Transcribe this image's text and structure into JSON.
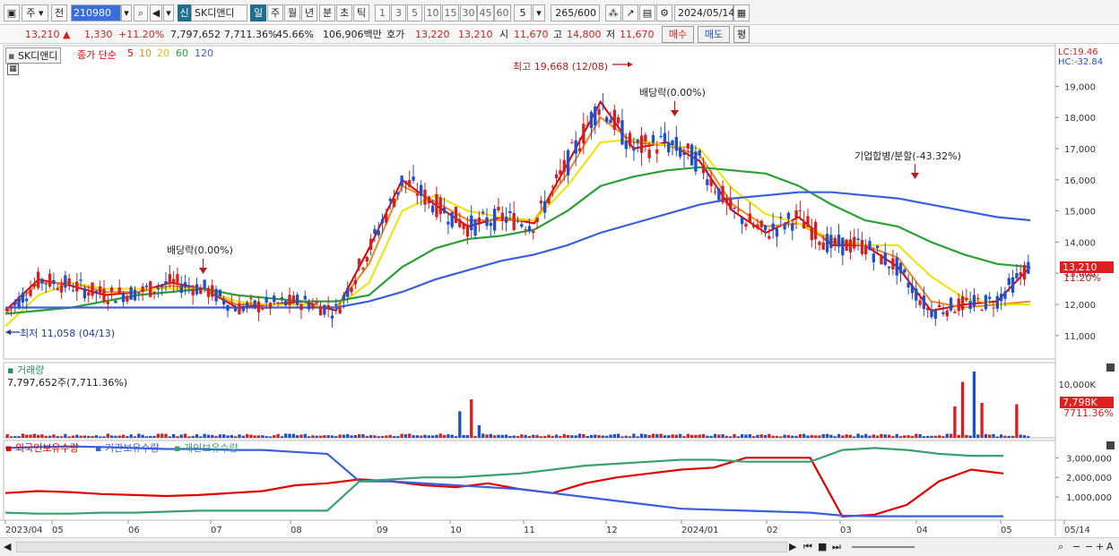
{
  "toolbar": {
    "period_ju": "주",
    "prev_label": "전",
    "code": "210980",
    "new_badge": "신",
    "name": "SK디앤디",
    "period_tabs": [
      "일",
      "주",
      "월",
      "년",
      "분",
      "초",
      "틱"
    ],
    "interval_buttons": [
      "1",
      "3",
      "5",
      "10",
      "15",
      "30",
      "45",
      "60"
    ],
    "interval_value": "5",
    "count": "265",
    "count_total": "/600",
    "date": "2024/05/14"
  },
  "infobar": {
    "price": "13,210",
    "change": "1,330",
    "change_pct": "+11.20%",
    "volume": "7,797,652",
    "volume_pct": "7,711.36%",
    "turnover": "45.66%",
    "amount": "106,906백만",
    "quote_label": "호가",
    "ask": "13,220",
    "bid": "13,210",
    "open_label": "시",
    "open": "11,670",
    "high_label": "고",
    "high": "14,800",
    "low_label": "저",
    "low": "11,670",
    "buy_label": "매수",
    "sell_label": "매도",
    "eval_label": "평"
  },
  "legend": {
    "name": "SK디앤디",
    "indicator": "종가 단순",
    "ma": [
      "5",
      "10",
      "20",
      "60",
      "120"
    ]
  },
  "colors": {
    "ma5": "#e00000",
    "ma10": "#f08a1c",
    "ma20": "#f2e200",
    "ma60": "#2aa035",
    "ma120": "#3a5fe0",
    "up": "#d42020",
    "down": "#1f4fcf",
    "foreign": "#e00000",
    "institution": "#3a5fe0",
    "individual": "#3aa070"
  },
  "annotations": {
    "high": "최고 19,668 (12/08)",
    "low": "최저 11,058 (04/13)",
    "div1": "배당락(0.00%)",
    "div2": "배당락(0.00%)",
    "merge": "기업합병/분할(-43.32%)"
  },
  "right_info": {
    "lc": "LC:19.46",
    "hc": "HC:-32.84",
    "price_tag": "13,210",
    "pct_tag": "11.20%",
    "vol_tag": "7,798K",
    "vol_pct_tag": "7711.36%"
  },
  "volume_panel": {
    "title": "거래량",
    "value": "7,797,652주(7,711.36%)"
  },
  "holdings_panel": {
    "labels": [
      "외국인보유수량",
      "기관보유수량",
      "개인보유수량"
    ]
  },
  "chart_data": [
    {
      "type": "line",
      "title": "SK디앤디",
      "x_ticks": [
        "2023/04",
        "05",
        "06",
        "07",
        "08",
        "09",
        "10",
        "11",
        "12",
        "2024/01",
        "02",
        "03",
        "04",
        "05",
        "05/14"
      ],
      "yticks": [
        11000,
        12000,
        13000,
        14000,
        15000,
        16000,
        17000,
        18000,
        19000
      ],
      "ylim": [
        10250,
        20300
      ],
      "series": [
        {
          "name": "5",
          "values": [
            11800,
            12800,
            12600,
            12300,
            12400,
            12700,
            12500,
            11900,
            12000,
            12100,
            11800,
            13800,
            16000,
            15200,
            14500,
            14800,
            14600,
            16500,
            18500,
            17000,
            17200,
            16600,
            15000,
            14300,
            14800,
            13900,
            13900,
            13200,
            11800,
            12000,
            12100,
            13200
          ]
        },
        {
          "name": "10",
          "values": [
            11700,
            12700,
            12700,
            12400,
            12400,
            12600,
            12500,
            12000,
            12000,
            12000,
            11900,
            13300,
            15800,
            15300,
            14700,
            14700,
            14700,
            16200,
            18000,
            17200,
            17100,
            16800,
            15200,
            14500,
            14600,
            14000,
            13900,
            13500,
            12100,
            11900,
            12000,
            12100
          ]
        },
        {
          "name": "20",
          "values": [
            11300,
            12300,
            12700,
            12500,
            12500,
            12500,
            12500,
            12100,
            12000,
            12000,
            11900,
            12700,
            15000,
            15500,
            15000,
            14800,
            14700,
            15800,
            17200,
            17300,
            17100,
            17000,
            15700,
            14900,
            14600,
            14100,
            13900,
            13900,
            12900,
            12200,
            12000,
            12000
          ]
        },
        {
          "name": "60",
          "values": [
            11700,
            11800,
            11900,
            12100,
            12300,
            12400,
            12500,
            12300,
            12200,
            12100,
            12100,
            12300,
            13200,
            13800,
            14100,
            14200,
            14400,
            15000,
            15800,
            16100,
            16300,
            16400,
            16300,
            16200,
            15800,
            15200,
            14700,
            14500,
            14000,
            13600,
            13300,
            13200
          ]
        },
        {
          "name": "120",
          "values": [
            11900,
            11900,
            11900,
            11900,
            11900,
            11900,
            11900,
            11900,
            11900,
            11900,
            11900,
            12100,
            12400,
            12800,
            13100,
            13400,
            13600,
            13900,
            14300,
            14600,
            14900,
            15200,
            15400,
            15500,
            15600,
            15600,
            15500,
            15400,
            15200,
            15000,
            14800,
            14700
          ]
        }
      ]
    },
    {
      "type": "bar",
      "title": "거래량",
      "yticks": [
        10000
      ],
      "ylabel": "K"
    },
    {
      "type": "line",
      "title": "외국인보유수량 / 기관보유수량 / 개인보유수량",
      "yticks": [
        1000000,
        2000000,
        3000000
      ],
      "ytick_labels": [
        "1,000,000",
        "2,000,000",
        "3,000,000"
      ],
      "series": [
        {
          "name": "외국인보유수량",
          "values": [
            1200000,
            1300000,
            1250000,
            1150000,
            1100000,
            1050000,
            1100000,
            1200000,
            1300000,
            1600000,
            1700000,
            1900000,
            1800000,
            1600000,
            1500000,
            1700000,
            1400000,
            1200000,
            1700000,
            2000000,
            2200000,
            2400000,
            2500000,
            3000000,
            3000000,
            3000000,
            0,
            100000,
            600000,
            1800000,
            2400000,
            2200000
          ]
        },
        {
          "name": "기관보유수량",
          "values": [
            3500000,
            3550000,
            3580000,
            3550000,
            3500000,
            3450000,
            3450000,
            3400000,
            3400000,
            3300000,
            3200000,
            1800000,
            1800000,
            1700000,
            1600000,
            1500000,
            1400000,
            1200000,
            1000000,
            800000,
            600000,
            400000,
            350000,
            300000,
            250000,
            200000,
            50000,
            20000,
            20000,
            20000,
            20000,
            20000
          ]
        },
        {
          "name": "개인보유수량",
          "values": [
            200000,
            150000,
            150000,
            200000,
            200000,
            250000,
            300000,
            300000,
            300000,
            300000,
            300000,
            1800000,
            1900000,
            2000000,
            2000000,
            2100000,
            2200000,
            2400000,
            2600000,
            2700000,
            2800000,
            2900000,
            2900000,
            2800000,
            2800000,
            2800000,
            3400000,
            3500000,
            3400000,
            3200000,
            3100000,
            3100000
          ]
        }
      ]
    }
  ]
}
